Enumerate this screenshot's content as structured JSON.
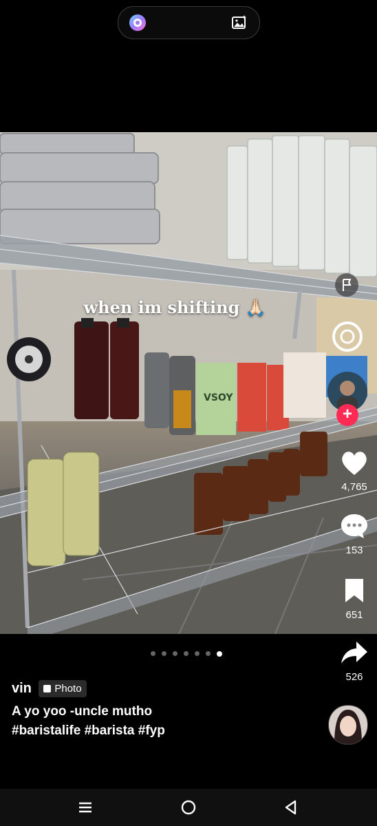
{
  "overlay_text": "when im shifting 🙏🏻",
  "actions": {
    "likes": "4,765",
    "comments": "153",
    "saves": "651",
    "shares": "526"
  },
  "carousel": {
    "total": 7,
    "active_index": 7
  },
  "post": {
    "username": "vin",
    "badge": "Photo",
    "caption_line1": "A yo yoo -uncle mutho",
    "caption_line2": "#baristalife #barista #fyp"
  },
  "product_labels": {
    "vsoy": "VSOY"
  },
  "colors": {
    "like": "#ffffff",
    "follow": "#fe2c55",
    "background": "#000000"
  }
}
